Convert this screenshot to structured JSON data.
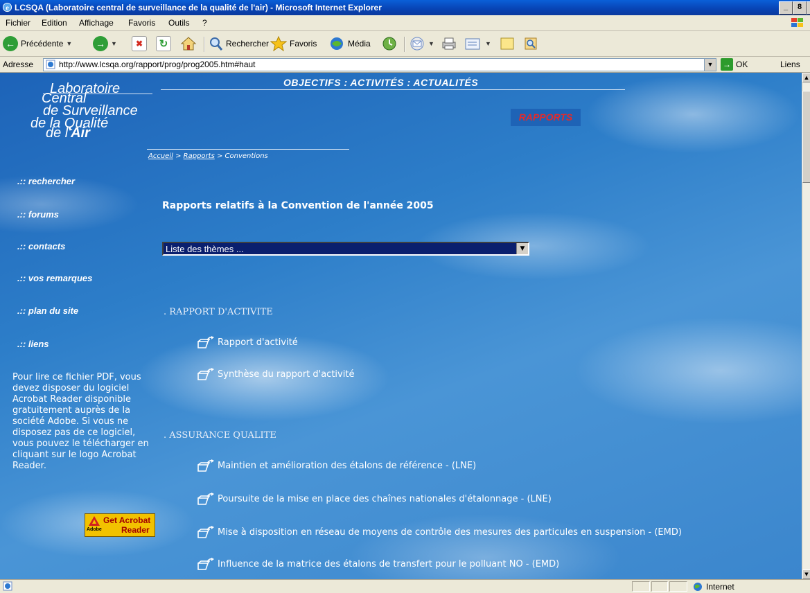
{
  "window": {
    "title": "LCSQA (Laboratoire central de surveillance de la qualité de l'air) - Microsoft Internet Explorer",
    "minimize": "_",
    "restore": "8",
    "close": "X"
  },
  "menu": [
    "Fichier",
    "Edition",
    "Affichage",
    "Favoris",
    "Outils",
    "?"
  ],
  "toolbar": {
    "back_label": "Précédente",
    "search_label": "Rechercher",
    "favorites_label": "Favoris",
    "media_label": "Média"
  },
  "address": {
    "label": "Adresse",
    "url": "http://www.lcsqa.org/rapport/prog/prog2005.htm#haut",
    "go_label": "OK",
    "links_label": "Liens"
  },
  "site": {
    "logo": {
      "line1": "Laboratoire",
      "line2": "Central",
      "line3": "de Surveillance",
      "line4": "de la Qualité",
      "line5_prefix": "de l'",
      "line5_bold": "Air"
    },
    "topnav": "OBJECTIFS  :  ACTIVITÉS  :  ACTUALITÉS",
    "section_badge": "RAPPORTS",
    "breadcrumb": {
      "home": "Accueil",
      "sep1": " > ",
      "reports": "Rapports",
      "sep2": " > ",
      "current": "Conventions"
    },
    "sidenav": [
      ".:: rechercher",
      ".:: forums",
      ".:: contacts",
      ".:: vos remarques",
      ".:: plan du site",
      ".:: liens"
    ],
    "pdf_note": "Pour lire ce fichier PDF, vous devez disposer du logiciel Acrobat Reader disponible gratuitement auprès de la société Adobe. Si vous ne disposez pas de ce logiciel, vous pouvez le télécharger en cliquant sur le logo Acrobat Reader.",
    "acrobat_button": {
      "top": "Get Acrobat",
      "bottom": "Reader",
      "brand": "Adobe"
    }
  },
  "main": {
    "heading": "Rapports relatifs à la Convention de l'année 2005",
    "theme_select": "Liste des thèmes ...",
    "sections": [
      {
        "title": ". RAPPORT D'ACTIVITE",
        "items": [
          "Rapport d'activité",
          "Synthèse du rapport d'activité"
        ]
      },
      {
        "title": ". ASSURANCE QUALITE",
        "items": [
          "Maintien et amélioration des étalons de référence - (LNE)",
          "Poursuite de la mise en place des chaînes nationales d'étalonnage - (LNE)",
          "Mise à disposition en réseau de moyens de contrôle des mesures des particules en suspension - (EMD)",
          "Influence de la matrice des étalons de transfert pour le polluant NO - (EMD)"
        ]
      }
    ]
  },
  "status": {
    "zone": "Internet"
  }
}
